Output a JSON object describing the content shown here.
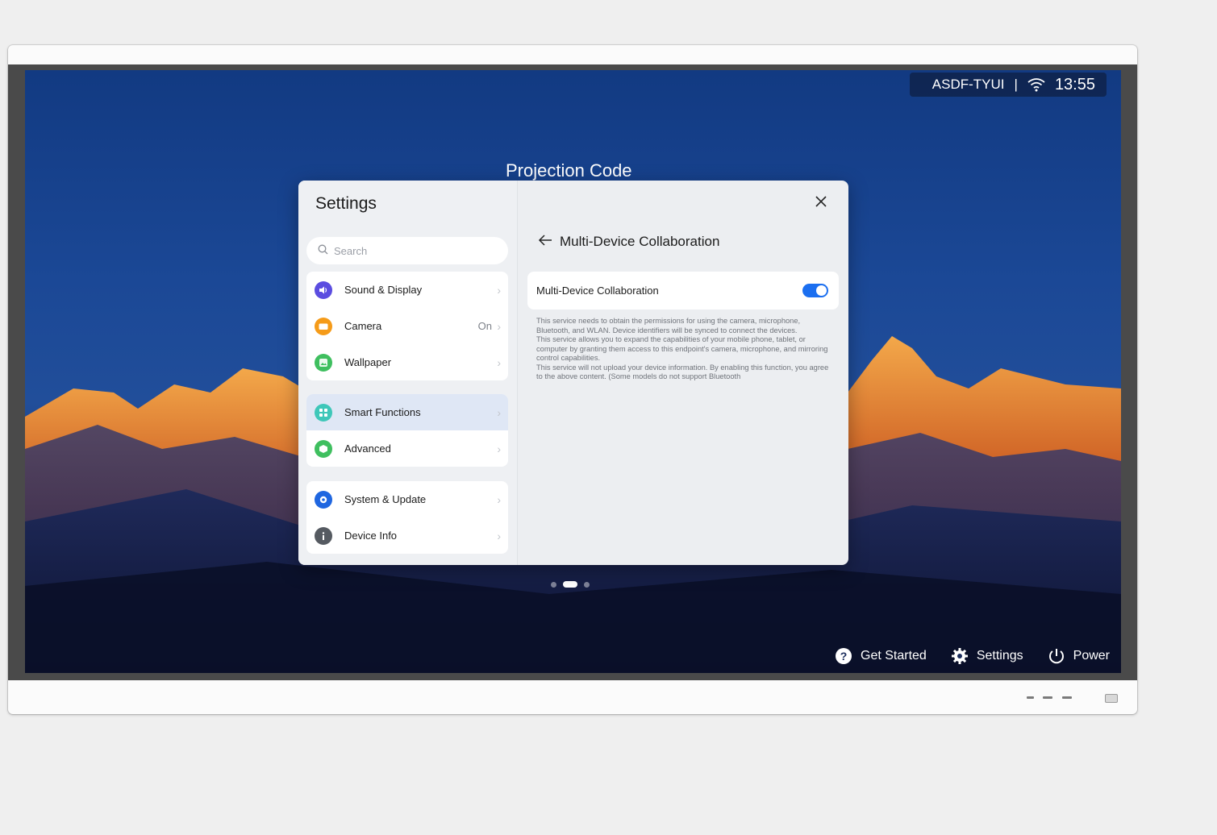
{
  "status_bar": {
    "device_name": "ASDF-TYUI",
    "separator": "|",
    "time": "13:55",
    "wifi_icon": "wifi-icon"
  },
  "screen": {
    "title": "Projection Code",
    "pager": {
      "count": 3,
      "active": 1
    }
  },
  "bottom_actions": [
    {
      "label": "Get Started",
      "icon": "help-icon"
    },
    {
      "label": "Settings",
      "icon": "gear-icon"
    },
    {
      "label": "Power",
      "icon": "power-icon"
    }
  ],
  "settings": {
    "title": "Settings",
    "search_placeholder": "Search",
    "groups": [
      [
        {
          "label": "Sound & Display",
          "icon": "speaker-icon",
          "color": "#5b4de0"
        },
        {
          "label": "Camera",
          "value": "On",
          "icon": "camera-icon",
          "color": "#f59b19"
        },
        {
          "label": "Wallpaper",
          "icon": "image-icon",
          "color": "#3fbf5f"
        }
      ],
      [
        {
          "label": "Smart Functions",
          "icon": "grid-icon",
          "color": "#3ec7b9",
          "selected": true
        },
        {
          "label": "Advanced",
          "icon": "cube-icon",
          "color": "#3fbf5f"
        }
      ],
      [
        {
          "label": "System & Update",
          "icon": "system-gear-icon",
          "color": "#1f66e0"
        },
        {
          "label": "Device Info",
          "icon": "info-icon",
          "color": "#555a61"
        }
      ]
    ],
    "detail": {
      "title": "Multi-Device Collaboration",
      "toggle_label": "Multi-Device Collaboration",
      "toggle_on": true,
      "description": [
        "This service needs to obtain the permissions for using the camera, microphone, Bluetooth, and WLAN. Device identifiers will be synced to connect the devices.",
        "This service allows you to expand the capabilities of your mobile phone, tablet, or computer by granting them access to this endpoint's camera, microphone, and mirroring control capabilities.",
        "This service will not upload your device information. By enabling this function, you agree to the above content. (Some models do not support Bluetooth"
      ]
    }
  },
  "colors": {
    "accent": "#1b6ff0",
    "selected_row": "#dfe7f5"
  }
}
